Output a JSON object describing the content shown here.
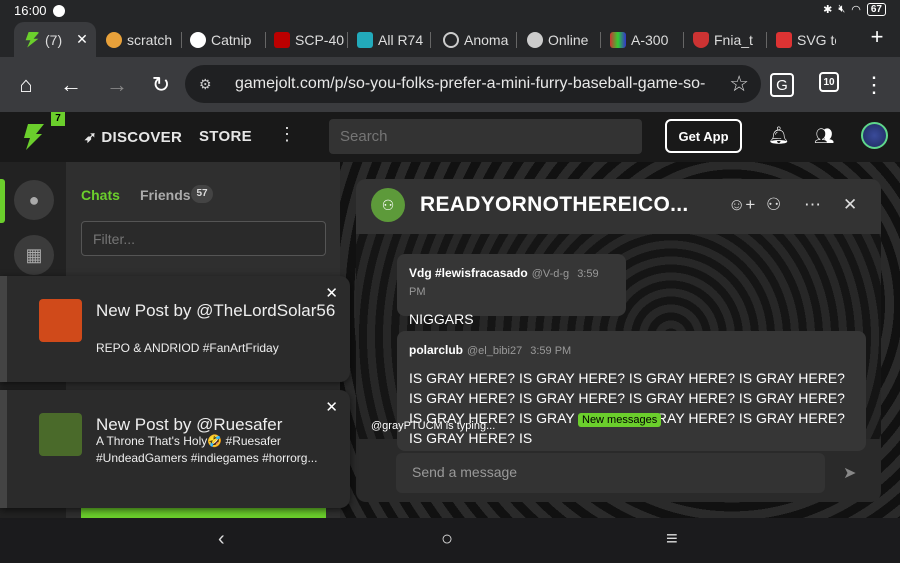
{
  "status": {
    "time": "16:00",
    "battery": "67"
  },
  "tabs": [
    {
      "label": "(7)",
      "icon": "gamejolt-icon",
      "color": "#6bcf2c"
    },
    {
      "label": "scratch",
      "icon": "scratch-icon",
      "color": "#e8a13a"
    },
    {
      "label": "Catnip",
      "icon": "openai-icon",
      "color": "#ffffff"
    },
    {
      "label": "SCP-40",
      "icon": "wiki-icon",
      "color": "#b00"
    },
    {
      "label": "All R74",
      "icon": "r74-icon",
      "color": "#2ab"
    },
    {
      "label": "Anoma",
      "icon": "anoma-icon",
      "color": "#ccc"
    },
    {
      "label": "Online",
      "icon": "globe-icon",
      "color": "#ccc"
    },
    {
      "label": "A-300",
      "icon": "a300-icon",
      "color": "#c33"
    },
    {
      "label": "Fnia_t",
      "icon": "fnia-icon",
      "color": "#c33"
    },
    {
      "label": "SVG to",
      "icon": "svg-icon",
      "color": "#d33"
    }
  ],
  "toolbar": {
    "url": "gamejolt.com/p/so-you-folks-prefer-a-mini-furry-baseball-game-so-far-ht",
    "tab_count": "10"
  },
  "gamejolt": {
    "notif_count": "7",
    "discover": "DISCOVER",
    "store": "STORE",
    "search_placeholder": "Search",
    "get_app": "Get App"
  },
  "chat_panel": {
    "chats_tab": "Chats",
    "friends_tab": "Friends",
    "friends_count": "57",
    "filter_placeholder": "Filter..."
  },
  "room": {
    "title": "READYORNOTHEREICO...",
    "messages": [
      {
        "user": "Vdg #lewisfracasado",
        "handle": "@V-d-g",
        "time": "3:59 PM",
        "text": "NIGGARS"
      },
      {
        "user": "polarclub",
        "handle": "@el_bibi27",
        "time": "3:59 PM",
        "text": "IS GRAY HERE? IS GRAY HERE? IS GRAY HERE? IS GRAY HERE? IS GRAY HERE? IS GRAY HERE? IS GRAY HERE? IS GRAY HERE? IS GRAY HERE? IS GRAY HERE? IS GRAY HERE? IS GRAY HERE? IS GRAY HERE? IS"
      }
    ],
    "typing": "@grayPTUCM is typing...",
    "new_messages": "New messages",
    "composer_placeholder": "Send a message"
  },
  "toasts": [
    {
      "title": "New Post by @TheLordSolar56",
      "body": "REPO & ANDRIOD #FanArtFriday",
      "thumb_color": "#d04a1a"
    },
    {
      "title": "New Post by @Ruesafer",
      "body": "A Throne That's Holy🤣 #Ruesafer #UndeadGamers #indiegames #horrorg...",
      "thumb_color": "#4a6a2a"
    }
  ]
}
